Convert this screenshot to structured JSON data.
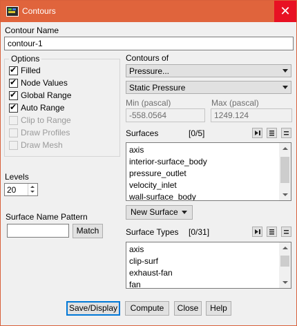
{
  "window": {
    "title": "Contours",
    "close_glyph": "✕"
  },
  "contour_name": {
    "label": "Contour Name",
    "value": "contour-1"
  },
  "options": {
    "legend": "Options",
    "items": [
      {
        "label": "Filled",
        "checked": true,
        "enabled": true
      },
      {
        "label": "Node Values",
        "checked": true,
        "enabled": true
      },
      {
        "label": "Global Range",
        "checked": true,
        "enabled": true
      },
      {
        "label": "Auto Range",
        "checked": true,
        "enabled": true
      },
      {
        "label": "Clip to Range",
        "checked": false,
        "enabled": false
      },
      {
        "label": "Draw Profiles",
        "checked": false,
        "enabled": false
      },
      {
        "label": "Draw Mesh",
        "checked": false,
        "enabled": false
      }
    ]
  },
  "levels": {
    "label": "Levels",
    "value": "20"
  },
  "surface_name_pattern": {
    "label": "Surface Name Pattern",
    "value": "",
    "match_label": "Match"
  },
  "contours_of": {
    "label": "Contours of",
    "category": "Pressure...",
    "quantity": "Static Pressure"
  },
  "range": {
    "min_label": "Min (pascal)",
    "min_value": "-558.0564",
    "max_label": "Max (pascal)",
    "max_value": "1249.124"
  },
  "surfaces": {
    "label": "Surfaces",
    "count": "[0/5]",
    "items": [
      "axis",
      "interior-surface_body",
      "pressure_outlet",
      "velocity_inlet",
      "wall-surface_body"
    ],
    "new_surface_label": "New Surface"
  },
  "surface_types": {
    "label": "Surface Types",
    "count": "[0/31]",
    "items": [
      "axis",
      "clip-surf",
      "exhaust-fan",
      "fan"
    ]
  },
  "buttons": {
    "save_display": "Save/Display",
    "compute": "Compute",
    "close": "Close",
    "help": "Help"
  },
  "icons": {
    "select_all": "select-all-icon",
    "select_list": "list-icon",
    "deselect": "deselect-icon"
  }
}
